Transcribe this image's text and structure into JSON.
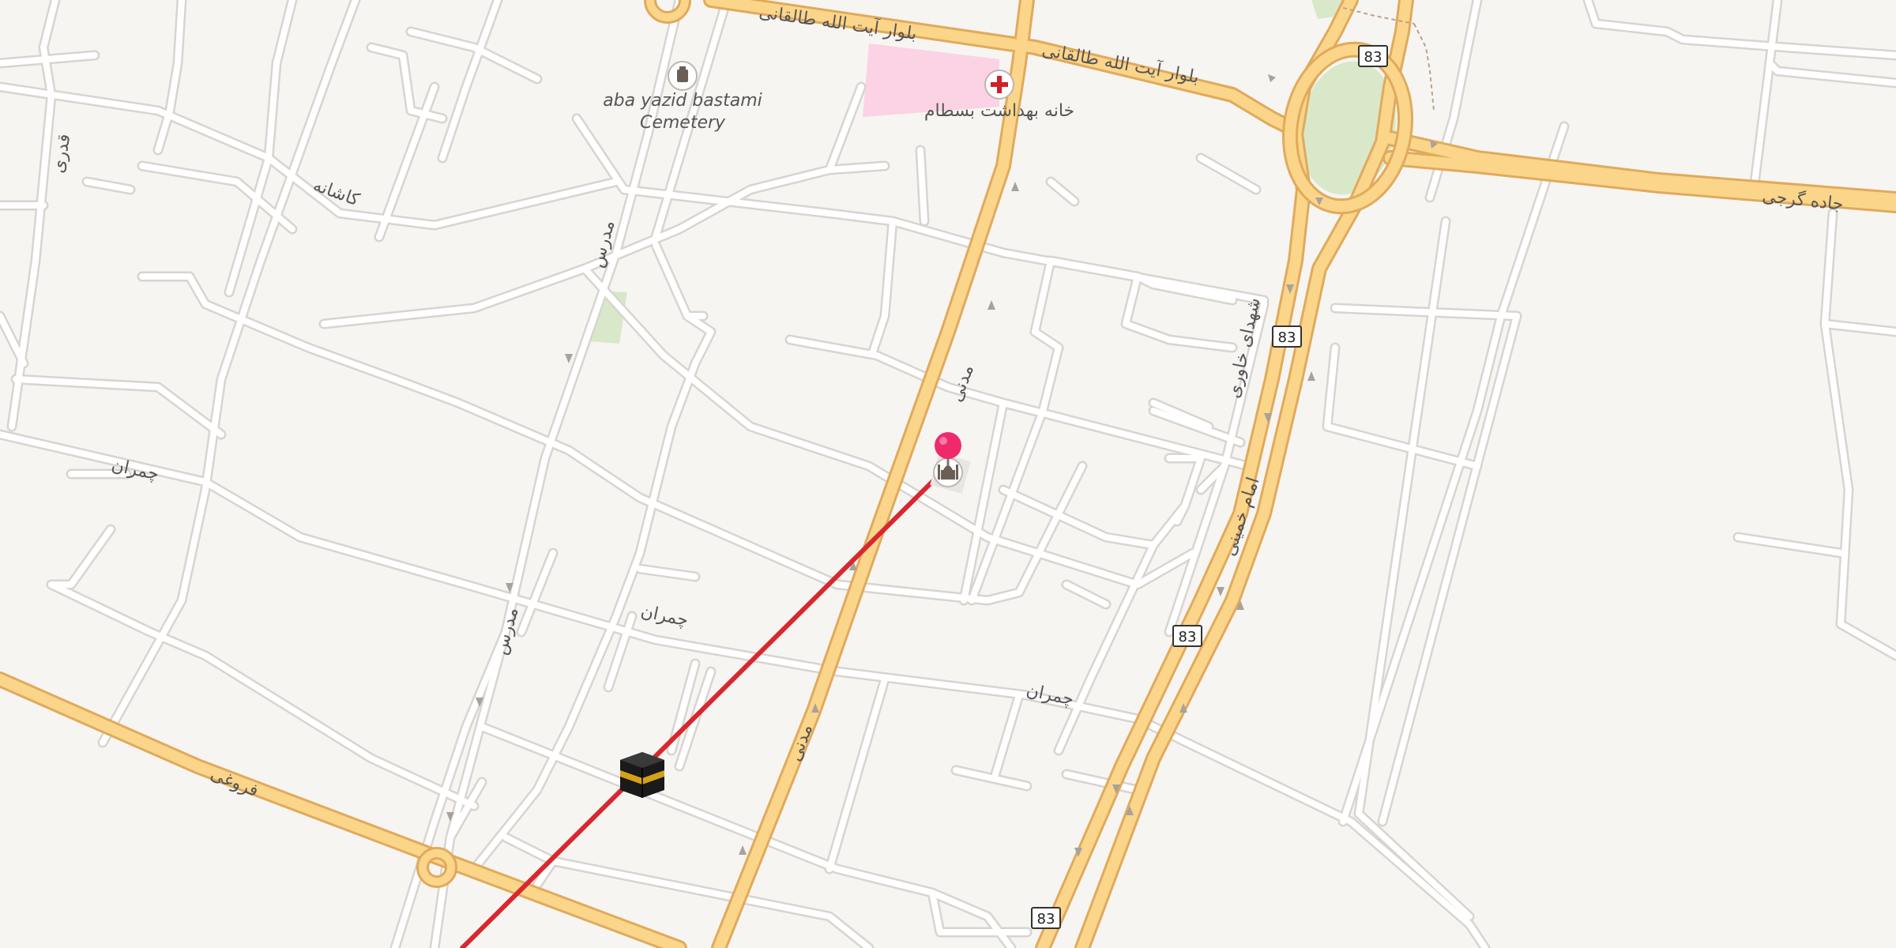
{
  "map": {
    "colors": {
      "background": "#f7f5f2",
      "minor_road": "#ffffff",
      "minor_casing": "#d8d4cf",
      "major_road": "#fbd58a",
      "major_casing": "#e0aa5c",
      "park": "#d9e8c8",
      "hospital_area": "#fbd3e4",
      "qibla_line": "#d8282f",
      "pin": "#ef2a6c",
      "shield_border": "#333333"
    },
    "icons": [
      "cemetery-icon",
      "hospital-icon",
      "mosque-icon",
      "kaaba-icon",
      "location-pin-icon",
      "route-shield"
    ],
    "labels": {
      "cemetery": "aba yazid bastami Cemetery",
      "cemetery_line1": "aba yazid bastami",
      "cemetery_line2": "Cemetery",
      "health_house": "خانه بهداشت بسطام",
      "boulevard_taleghani_1": "بلوار آیت الله طالقانی",
      "boulevard_taleghani_2": "بلوار آیت الله طالقانی",
      "jadeh_gorji": "جاده گرجی",
      "kashaneh": "کاشانه",
      "modarres_1": "مدرس",
      "modarres_2": "مدرس",
      "fareghi": "قدری",
      "motahari_1": "مدنی",
      "motahari_2": "مدنی",
      "shohada_khavari": "شهدای خاوری",
      "imam_khomeini": "امام خمینی",
      "chamran_1": "چمران",
      "chamran_2": "چمران",
      "chamran_3": "چمران",
      "forooghi": "فروغی"
    },
    "route_shields": [
      "83",
      "83",
      "83",
      "83"
    ]
  }
}
